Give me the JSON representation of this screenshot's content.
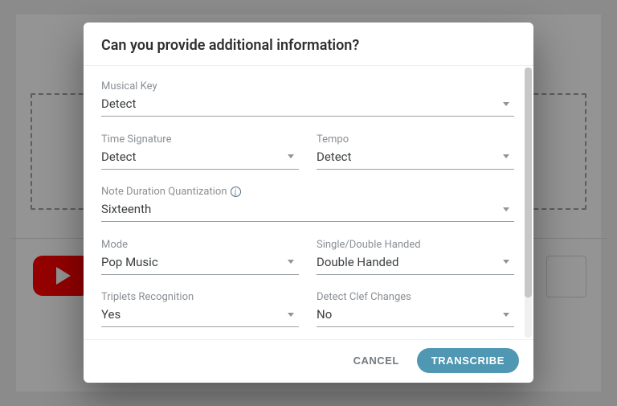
{
  "modal": {
    "title": "Can you provide additional information?",
    "cancel_label": "CANCEL",
    "submit_label": "TRANSCRIBE"
  },
  "fields": {
    "musical_key": {
      "label": "Musical Key",
      "value": "Detect"
    },
    "time_signature": {
      "label": "Time Signature",
      "value": "Detect"
    },
    "tempo": {
      "label": "Tempo",
      "value": "Detect"
    },
    "quantization": {
      "label": "Note Duration Quantization",
      "value": "Sixteenth"
    },
    "mode": {
      "label": "Mode",
      "value": "Pop Music"
    },
    "handed": {
      "label": "Single/Double Handed",
      "value": "Double Handed"
    },
    "triplets": {
      "label": "Triplets Recognition",
      "value": "Yes"
    },
    "clef": {
      "label": "Detect Clef Changes",
      "value": "No"
    }
  }
}
